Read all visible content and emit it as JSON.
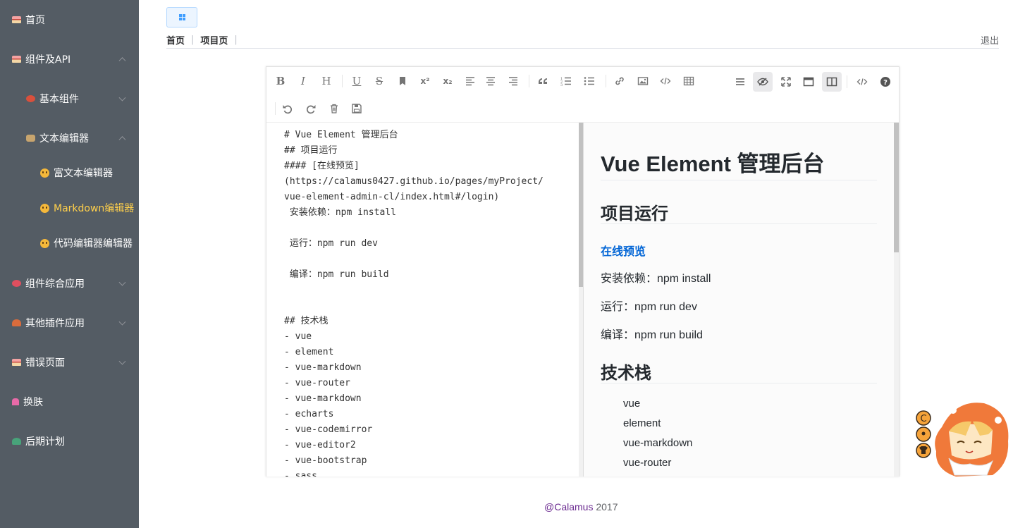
{
  "sidebar": {
    "items": [
      {
        "label": "首页",
        "level": 1
      },
      {
        "label": "组件及API",
        "level": 1,
        "chevron": "up"
      },
      {
        "label": "基本组件",
        "level": 2,
        "chevron": "down"
      },
      {
        "label": "文本编辑器",
        "level": 2,
        "chevron": "up"
      },
      {
        "label": "富文本编辑器",
        "level": 3
      },
      {
        "label": "Markdown编辑器",
        "level": 3,
        "active": true
      },
      {
        "label": "代码编辑器编辑器",
        "level": 3
      },
      {
        "label": "组件综合应用",
        "level": 1,
        "chevron": "down"
      },
      {
        "label": "其他插件应用",
        "level": 1,
        "chevron": "down"
      },
      {
        "label": "错误页面",
        "level": 1,
        "chevron": "down"
      },
      {
        "label": "换肤",
        "level": 1
      },
      {
        "label": "后期计划",
        "level": 1
      }
    ],
    "colors": {
      "background": "#545c64",
      "text": "#ffffff",
      "active": "#ffd04b"
    }
  },
  "header": {
    "toggle_icon": "grid-icon",
    "breadcrumb": [
      "首页",
      "项目页"
    ],
    "logout_label": "退出"
  },
  "editor": {
    "toolbar": {
      "row1": [
        "bold",
        "italic",
        "heading",
        "underline",
        "strikethrough",
        "mark",
        "superscript",
        "subscript",
        "align-left",
        "align-center",
        "align-right",
        "quote",
        "ordered-list",
        "unordered-list",
        "link",
        "image",
        "code",
        "table"
      ],
      "right": [
        "navigation",
        "preview-toggle",
        "fullscreen",
        "read-mode",
        "subfield",
        "html-code",
        "help"
      ],
      "row2": [
        "undo",
        "redo",
        "trash",
        "save"
      ],
      "glyphs": {
        "bold": "B",
        "italic": "I",
        "heading": "H",
        "underline": "U",
        "strikethrough": "S",
        "superscript": "x²",
        "subscript": "x₂"
      }
    },
    "source": "# Vue Element 管理后台\n## 项目运行\n#### [在线预览]\n(https://calamus0427.github.io/pages/myProject/\nvue-element-admin-cl/index.html#/login)\n 安装依赖：npm install\n\n 运行：npm run dev\n\n 编译：npm run build\n\n\n## 技术栈\n- vue\n- element\n- vue-markdown\n- vue-router\n- vue-markdown\n- echarts\n- vue-codemirror\n- vue-editor2\n- vue-bootstrap\n- sass",
    "preview": {
      "h1": "Vue Element 管理后台",
      "h2_run": "项目运行",
      "link": "在线预览",
      "p1": "安装依赖：npm install",
      "p2": "运行：npm run dev",
      "p3": "编译：npm run build",
      "h2_stack": "技术栈",
      "list": [
        "vue",
        "element",
        "vue-markdown",
        "vue-router"
      ],
      "link_color": "#0366d6"
    }
  },
  "footer": {
    "name": "@Calamus",
    "year": "2017"
  }
}
